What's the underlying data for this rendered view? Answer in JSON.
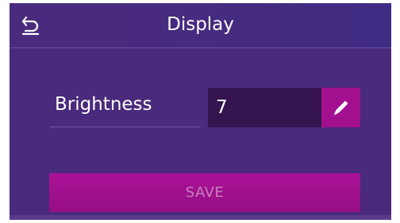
{
  "header": {
    "title": "Display",
    "back_icon": "back-arrow-icon"
  },
  "setting": {
    "label": "Brightness",
    "value": "7",
    "edit_icon": "pencil-icon"
  },
  "actions": {
    "save_label": "SAVE"
  },
  "colors": {
    "background": "#4a2a7c",
    "header": "#452b80",
    "value_box": "#35144f",
    "accent": "#a3108f",
    "save_text_disabled": "#c97fbf"
  }
}
